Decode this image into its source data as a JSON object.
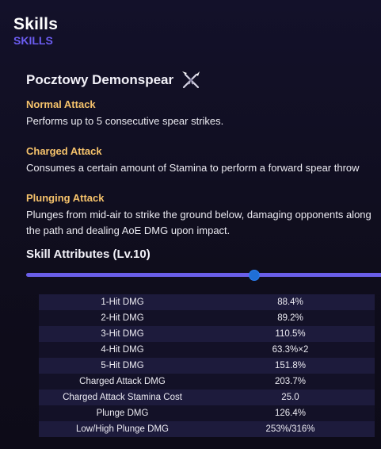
{
  "header": {
    "title": "Skills",
    "subtitle": "SKILLS"
  },
  "weapon": {
    "name": "Pocztowy Demonspear",
    "icon": "crossed-spears-icon"
  },
  "attacks": [
    {
      "name": "Normal Attack",
      "description": "Performs up to 5 consecutive spear strikes."
    },
    {
      "name": "Charged Attack",
      "description": "Consumes a certain amount of Stamina to perform a forward spear throw"
    },
    {
      "name": "Plunging Attack",
      "description": "Plunges from mid-air to strike the ground below, damaging opponents along the path and dealing AoE DMG upon impact."
    }
  ],
  "skill_attributes": {
    "title": "Skill Attributes (Lv.10)",
    "level_fraction": 0.627,
    "colors": {
      "track": "#6a5ee8",
      "thumb": "#1f6fd6"
    },
    "rows": [
      {
        "label": "1-Hit DMG",
        "value": "88.4%"
      },
      {
        "label": "2-Hit DMG",
        "value": "89.2%"
      },
      {
        "label": "3-Hit DMG",
        "value": "110.5%"
      },
      {
        "label": "4-Hit DMG",
        "value": "63.3%×2"
      },
      {
        "label": "5-Hit DMG",
        "value": "151.8%"
      },
      {
        "label": "Charged Attack DMG",
        "value": "203.7%"
      },
      {
        "label": "Charged Attack Stamina Cost",
        "value": "25.0"
      },
      {
        "label": "Plunge DMG",
        "value": "126.4%"
      },
      {
        "label": "Low/High Plunge DMG",
        "value": "253%/316%"
      }
    ]
  }
}
